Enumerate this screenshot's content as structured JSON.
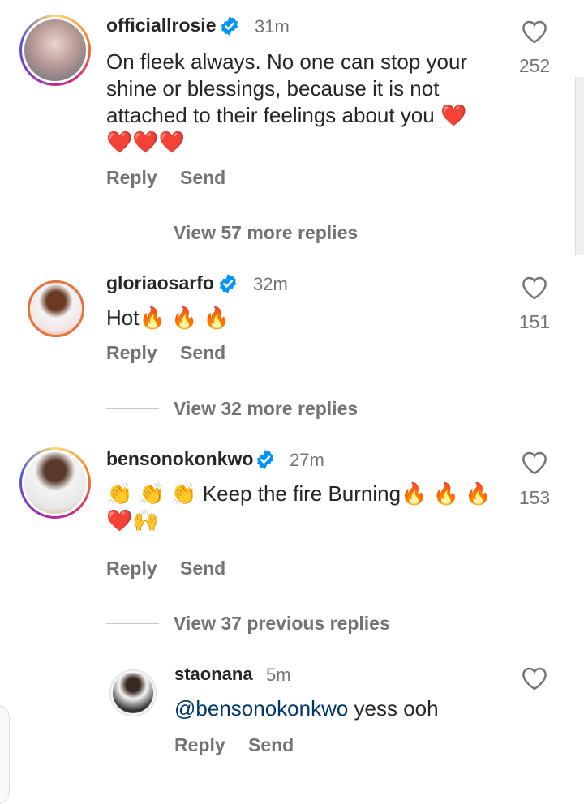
{
  "comments": [
    {
      "username": "officiallrosie",
      "time": "31m",
      "text_line1": "On fleek always. No one can stop your",
      "text_line2": "shine or blessings, because it is not",
      "text_line3": "attached to their feelings about you ❤️",
      "text_line4": "❤️❤️❤️",
      "likes": "252",
      "reply": "Reply",
      "send": "Send",
      "view_replies": "View 57 more replies"
    },
    {
      "username": "gloriaosarfo",
      "time": "32m",
      "text": "Hot🔥 🔥 🔥",
      "likes": "151",
      "reply": "Reply",
      "send": "Send",
      "view_replies": "View 32 more replies"
    },
    {
      "username": "bensonokonkwo",
      "time": "27m",
      "text_line1": "👏 👏 👏 Keep the fire Burning🔥 🔥 🔥",
      "text_line2": "❤️🙌",
      "likes": "153",
      "reply": "Reply",
      "send": "Send",
      "view_replies": "View 37 previous replies"
    }
  ],
  "reply": {
    "username": "staonana",
    "time": "5m",
    "mention": "@bensonokonkwo",
    "text": " yess ooh",
    "reply": "Reply",
    "send": "Send"
  },
  "colors": {
    "verified": "#0095f6",
    "mention": "#00376b",
    "secondary_text": "#737373"
  }
}
